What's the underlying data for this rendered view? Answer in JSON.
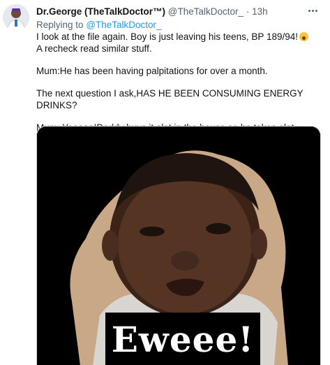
{
  "tweet": {
    "display_name": "Dr.George (TheTalkDoctor™)",
    "handle": "@TheTalkDoctor_",
    "separator": "·",
    "time": "13h",
    "replying_prefix": "Replying to",
    "replying_handle": "@TheTalkDoctor_",
    "lines": [
      "I look at the file again. Boy is just leaving his teens, BP 189/94!",
      "A recheck read similar stuff.",
      "Mum:He has been having palpitations for over a month.",
      "The next question I ask,HAS HE BEEN CONSUMING ENERGY DRINKS?",
      "Mum: Yeaaaa!Daddy buys it alot in the house so he takes alot"
    ],
    "emoji": "astonished-face-emoji"
  },
  "media": {
    "caption": "Eweee!"
  },
  "icons": {
    "more": "more-horizontal-icon",
    "avatar": "avatar-icon"
  },
  "colors": {
    "link": "#1d9bf0",
    "secondary_text": "#536471",
    "primary_text": "#0f1419",
    "media_background": "#000000",
    "sticker_border": "#c8a886"
  }
}
